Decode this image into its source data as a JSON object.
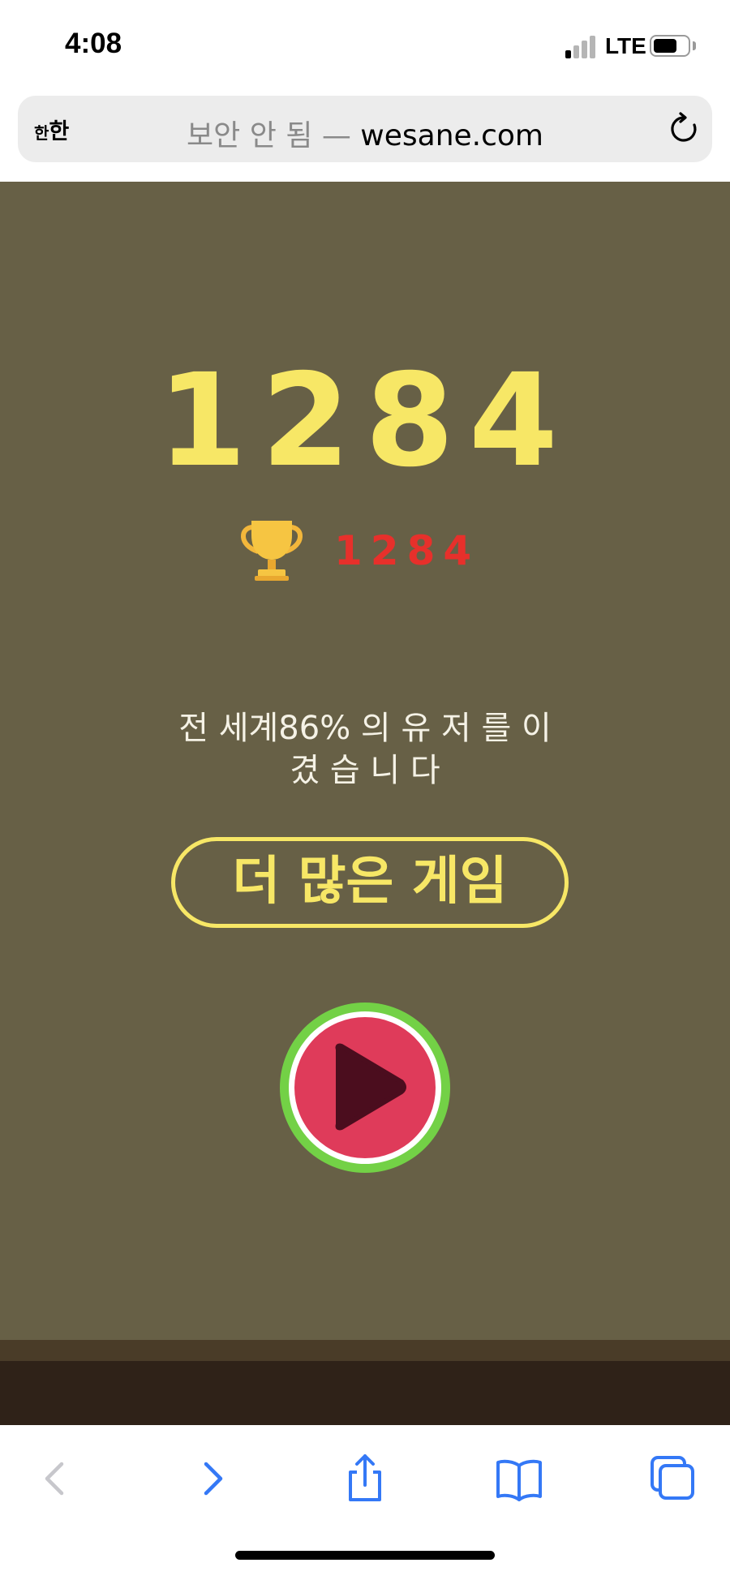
{
  "status_bar": {
    "time": "4:08",
    "network": "LTE"
  },
  "browser": {
    "aa_label_small": "한",
    "aa_label_large": "한",
    "url_insecure_label": "보안 안 됨 —",
    "url_domain": "wesane.com"
  },
  "game": {
    "score": "1284",
    "best_score": "1284",
    "rank_line1": "전 세계86% 의 유 저 를 이",
    "rank_line2": "겼 습 니 다",
    "more_games_label": "더 많은 게임",
    "colors": {
      "background": "#676046",
      "score_yellow": "#f7e766",
      "best_red": "#e7302b",
      "play_red": "#df3b5a",
      "play_green": "#73d146"
    }
  },
  "toolbar": {
    "icons": [
      "back-icon",
      "forward-icon",
      "share-icon",
      "bookmarks-icon",
      "tabs-icon"
    ],
    "accent": "#3478f6"
  }
}
